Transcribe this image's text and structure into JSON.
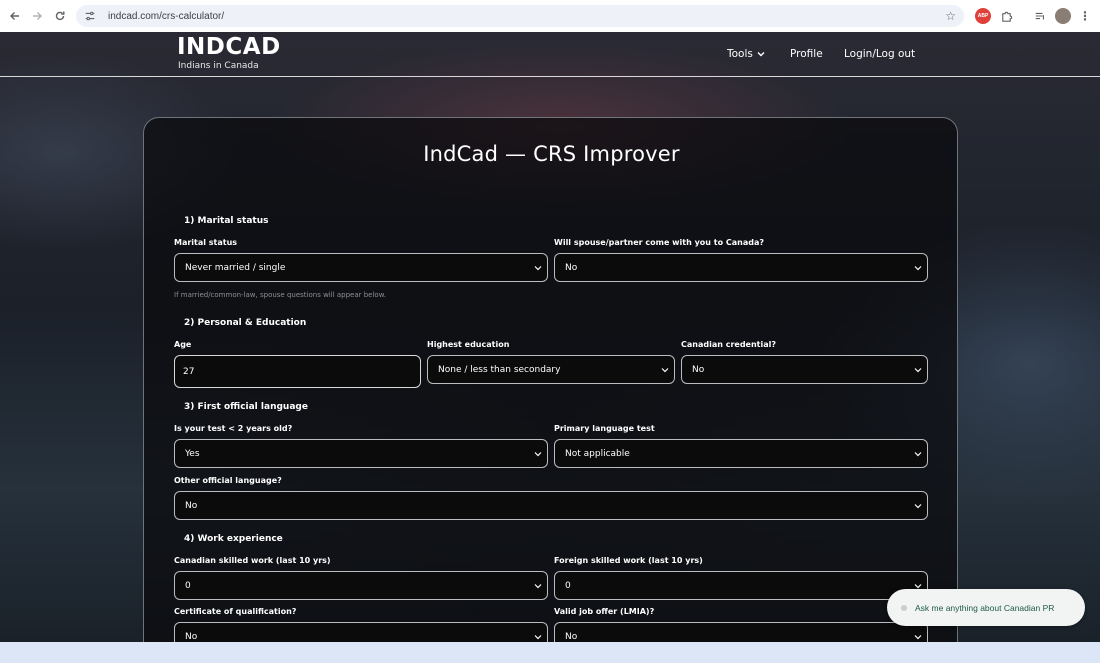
{
  "browser": {
    "url": "indcad.com/crs-calculator/",
    "extension_badge": "ABP"
  },
  "site": {
    "logo": "INDCAD",
    "tagline": "Indians in Canada",
    "nav": {
      "tools": "Tools",
      "profile": "Profile",
      "login": "Login/Log out"
    }
  },
  "form": {
    "title": "IndCad — CRS Improver",
    "marital": {
      "heading": "1) Marital status",
      "status_label": "Marital status",
      "status_value": "Never married / single",
      "spouse_label": "Will spouse/partner come with you to Canada?",
      "spouse_value": "No",
      "hint": "If married/common-law, spouse questions will appear below."
    },
    "personal": {
      "heading": "2) Personal & Education",
      "age_label": "Age",
      "age_value": "27",
      "education_label": "Highest education",
      "education_value": "None / less than secondary",
      "credential_label": "Canadian credential?",
      "credential_value": "No"
    },
    "language": {
      "heading": "3) First official language",
      "recent_label": "Is your test < 2 years old?",
      "recent_value": "Yes",
      "test_label": "Primary language test",
      "test_value": "Not applicable",
      "other_label": "Other official language?",
      "other_value": "No"
    },
    "work": {
      "heading": "4) Work experience",
      "canadian_label": "Canadian skilled work (last 10 yrs)",
      "canadian_value": "0",
      "foreign_label": "Foreign skilled work (last 10 yrs)",
      "foreign_value": "0",
      "certificate_label": "Certificate of qualification?",
      "certificate_value": "No",
      "offer_label": "Valid job offer (LMIA)?",
      "offer_value": "No"
    }
  },
  "chat": {
    "prompt": "Ask me anything about Canadian PR"
  }
}
